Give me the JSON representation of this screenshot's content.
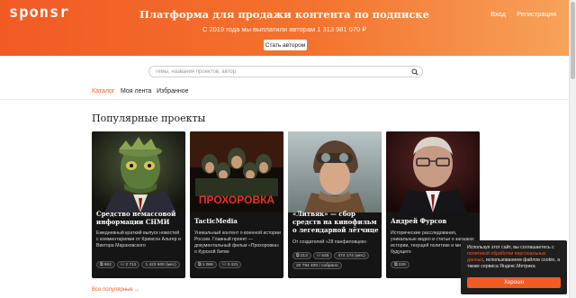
{
  "header": {
    "logo": "sponsr",
    "title": "Платформа для продажи контента по подписке",
    "subtitle": "С 2019 года мы выплатили авторам 1 313 981 070 ₽",
    "author_button": "Стать автором",
    "login": "Вход",
    "register": "Регистрация"
  },
  "search": {
    "placeholder": "Темы, названия проектов, автор"
  },
  "tabs": [
    {
      "label": "Каталог",
      "active": true
    },
    {
      "label": "Моя лента",
      "active": false
    },
    {
      "label": "Избранное",
      "active": false
    }
  ],
  "section_title": "Популярные проекты",
  "cards": [
    {
      "title": "Средство немассовой информации СНМИ",
      "description": "Ежедневный краткий выпуск новостей с комментариями от Кримсон Альтер и Виктора Мараховского",
      "stats": [
        "962",
        "2 712",
        "1 423 500 (мес)"
      ]
    },
    {
      "title": "TacticMedia",
      "description": "Уникальный контент о военной истории России. Главный проект — документальный фильм «Прохоровка» о Курской битве",
      "stats": [
        "1 066",
        "3 421"
      ],
      "poster_title": "ПРОХОРОВКА"
    },
    {
      "title": "«Литвяк» — сбор средств на кинофильм о легендарной лётчице",
      "description": "От создателей «28 панфиловцев»",
      "stats": [
        "213",
        "545",
        "474 174 (мес)",
        "20 794 400 / собрано"
      ]
    },
    {
      "title": "Андрей Фурсов",
      "description": "Исторические расследования, уникальные видео и статьи о загадках истории, текущей политике и мире будущего",
      "stats": [
        "226"
      ]
    }
  ],
  "all_link": "Все популярные →",
  "cookie": {
    "text_before": "Используя этот сайт, вы соглашаетесь с ",
    "link": "политикой обработки персональных данных",
    "text_after": ", использованием файлов cookie, а также сервиса Яндекс.Метрика",
    "button": "Хорошо"
  },
  "colors": {
    "accent": "#f25a24",
    "card_bg": "#151515"
  }
}
